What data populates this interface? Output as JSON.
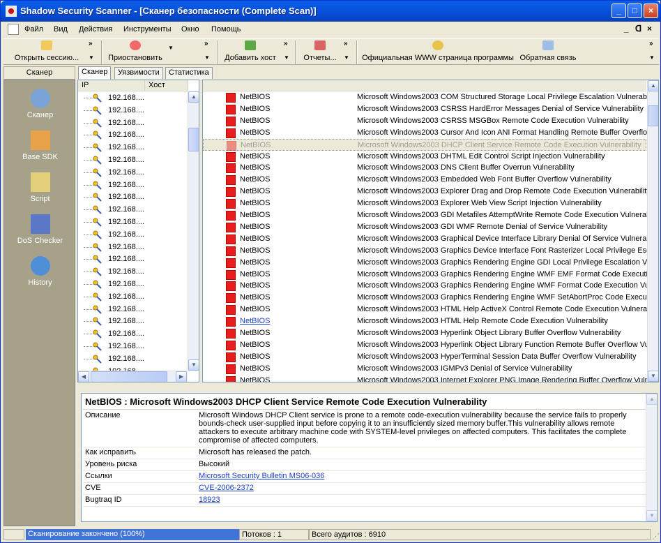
{
  "window": {
    "title": "Shadow Security Scanner - [Сканер безопасности (Complete Scan)]"
  },
  "menu": [
    "Файл",
    "Вид",
    "Действия",
    "Инструменты",
    "Окно",
    "Помощь"
  ],
  "toolbar": {
    "open_session": "Открыть сессию...",
    "pause": "Приостановить",
    "add_host": "Добавить хост",
    "reports": "Отчеты...",
    "website": "Официальная WWW страница программы",
    "feedback": "Обратная связь"
  },
  "sidebar": {
    "header": "Сканер",
    "items": [
      {
        "label": "Сканер",
        "icon": "scanner-icon"
      },
      {
        "label": "Base SDK",
        "icon": "base-sdk-icon"
      },
      {
        "label": "Script",
        "icon": "script-icon"
      },
      {
        "label": "DoS Checker",
        "icon": "dos-checker-icon"
      },
      {
        "label": "History",
        "icon": "history-icon"
      }
    ]
  },
  "tabs": [
    "Сканер",
    "Уязвимости",
    "Статистика"
  ],
  "hosts": {
    "columns": [
      "IP",
      "Хост"
    ],
    "rows": [
      "192.168....",
      "192.168....",
      "192.168....",
      "192.168....",
      "192.168....",
      "192.168....",
      "192.168....",
      "192.168....",
      "192.168....",
      "192.168....",
      "192.168....",
      "192.168....",
      "192.168....",
      "192.168....",
      "192.168....",
      "192.168....",
      "192.168....",
      "192.168....",
      "192.168....",
      "192.168....",
      "192.168....",
      "192.168....",
      "192.168....",
      "192.168...."
    ]
  },
  "vulnerabilities": [
    {
      "service": "NetBIOS",
      "name": "Microsoft Windows2003 COM Structured Storage Local Privilege Escalation Vulnerability"
    },
    {
      "service": "NetBIOS",
      "name": "Microsoft Windows2003 CSRSS HardError Messages Denial of Service Vulnerability"
    },
    {
      "service": "NetBIOS",
      "name": "Microsoft Windows2003 CSRSS MSGBox Remote Code Execution Vulnerability"
    },
    {
      "service": "NetBIOS",
      "name": "Microsoft Windows2003 Cursor And Icon ANI Format Handling Remote Buffer Overflow V"
    },
    {
      "service": "NetBIOS",
      "name": "Microsoft Windows2003 DHCP Client Service Remote Code Execution Vulnerability",
      "selected": true
    },
    {
      "service": "NetBIOS",
      "name": "Microsoft Windows2003 DHTML Edit Control Script Injection Vulnerability"
    },
    {
      "service": "NetBIOS",
      "name": "Microsoft Windows2003 DNS Client Buffer Overrun Vulnerability"
    },
    {
      "service": "NetBIOS",
      "name": "Microsoft Windows2003 Embedded Web Font Buffer Overflow Vulnerability"
    },
    {
      "service": "NetBIOS",
      "name": "Microsoft Windows2003 Explorer Drag and Drop Remote Code Execution Vulnerability"
    },
    {
      "service": "NetBIOS",
      "name": "Microsoft Windows2003 Explorer Web View Script Injection Vulnerability"
    },
    {
      "service": "NetBIOS",
      "name": "Microsoft Windows2003 GDI Metafiles AttemptWrite Remote Code Execution Vulnerabilit"
    },
    {
      "service": "NetBIOS",
      "name": "Microsoft Windows2003 GDI WMF Remote Denial of Service Vulnerability"
    },
    {
      "service": "NetBIOS",
      "name": "Microsoft Windows2003 Graphical Device Interface Library Denial Of Service Vulnerabili"
    },
    {
      "service": "NetBIOS",
      "name": "Microsoft Windows2003 Graphics Device Interface Font Rasterizer Local Privilege Escal"
    },
    {
      "service": "NetBIOS",
      "name": "Microsoft Windows2003 Graphics Rendering Engine GDI Local Privilege Escalation Vulne"
    },
    {
      "service": "NetBIOS",
      "name": "Microsoft Windows2003 Graphics Rendering Engine WMF EMF Format Code Execution"
    },
    {
      "service": "NetBIOS",
      "name": "Microsoft Windows2003 Graphics Rendering Engine WMF Format Code Execution Vulne"
    },
    {
      "service": "NetBIOS",
      "name": "Microsoft Windows2003 Graphics Rendering Engine WMF SetAbortProc Code Executior"
    },
    {
      "service": "NetBIOS",
      "name": "Microsoft Windows2003 HTML Help ActiveX Control Remote Code Execution Vulnerabili"
    },
    {
      "service": "NetBIOS",
      "name": "Microsoft Windows2003 HTML Help Remote Code Execution Vulnerability",
      "link": true
    },
    {
      "service": "NetBIOS",
      "name": "Microsoft Windows2003 Hyperlink Object Library Buffer Overflow Vulnerability"
    },
    {
      "service": "NetBIOS",
      "name": "Microsoft Windows2003 Hyperlink Object Library Function Remote Buffer Overflow Vulne"
    },
    {
      "service": "NetBIOS",
      "name": "Microsoft Windows2003 HyperTerminal Session Data Buffer Overflow Vulnerability"
    },
    {
      "service": "NetBIOS",
      "name": "Microsoft Windows2003 IGMPv3 Denial of Service Vulnerability"
    },
    {
      "service": "NetBIOS",
      "name": "Microsoft Windows2003 Internet Explorer PNG Image Rendering Buffer Overflow Vulnera"
    }
  ],
  "details": {
    "title": "NetBIOS : Microsoft Windows2003 DHCP Client Service Remote Code Execution Vulnerability",
    "description_label": "Описание",
    "description": "Microsoft Windows DHCP Client service is prone to a remote code-execution vulnerability because the service fails to properly bounds-check user-supplied input before copying it to an insufficiently sized memory buffer.This vulnerability allows remote attackers to execute arbitrary machine code with SYSTEM-level privileges on affected computers. This facilitates the complete compromise of affected computers.",
    "fix_label": "Как исправить",
    "fix": "Microsoft has released the patch.",
    "risk_label": "Уровень риска",
    "risk": "Высокий",
    "links_label": "Ссылки",
    "links": "Microsoft Security Bulletin MS06-036",
    "cve_label": "CVE",
    "cve": "CVE-2006-2372",
    "bugtraq_label": "Bugtraq ID",
    "bugtraq": "18923"
  },
  "status": {
    "progress_text": "Сканирование закончено (100%)",
    "progress_value": 1.0,
    "threads": "Потоков : 1",
    "total_audits": "Всего аудитов : 6910"
  },
  "colors": {
    "title_blue": "#0754e0",
    "vuln_red": "#e61e1e",
    "link_blue": "#1e41c8",
    "sidebar_bg": "#a6a28a"
  }
}
